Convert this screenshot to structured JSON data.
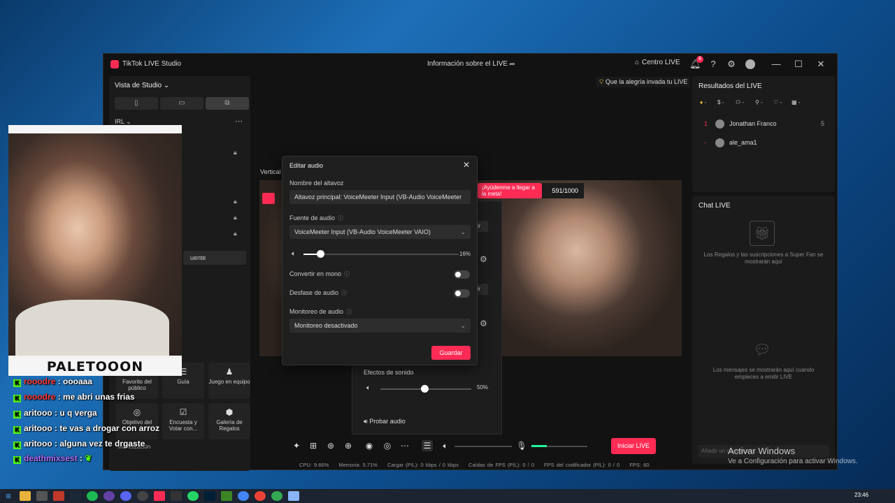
{
  "window": {
    "app_title": "TikTok LIVE Studio",
    "center_title": "Información sobre el LIVE",
    "live_center": "Centro LIVE",
    "notif_count": "8",
    "minimize": "—",
    "maximize": "☐",
    "close": "✕"
  },
  "left": {
    "studio_view": "Vista de Studio",
    "scene": "IRL",
    "add_source": "uente",
    "tools": [
      {
        "label": "Favorito del público",
        "icon": "★"
      },
      {
        "label": "Guía",
        "icon": "☰"
      },
      {
        "label": "Juego en equipo",
        "icon": "♟"
      },
      {
        "label": "Objetivo del",
        "icon": "◎"
      },
      {
        "label": "Encuesta y Votar con...",
        "icon": "☑"
      },
      {
        "label": "Galería de Regalos",
        "icon": "⬢"
      }
    ],
    "monetization": "Monetización"
  },
  "preview": {
    "label": "Vertical",
    "goal_text": "¡Ayúdenme a llegar a la meta!",
    "goal_count": "591/1000",
    "bulb_tip": "Que la alegría invada tu LIVE"
  },
  "audio_panel": {
    "edit": "dir",
    "edit2": "dir",
    "effects_label": "Efectos de sonido",
    "effects_pct": "50%",
    "test_audio": "Probar audio"
  },
  "dialog": {
    "title": "Editar audio",
    "speaker_label": "Nombre del altavoz",
    "speaker_value": "Altavoz principal: VoiceMeeter Input (VB-Audio VoiceMeeter",
    "source_label": "Fuente de audio",
    "source_value": "VoiceMeeter Input (VB-Audio VoiceMeeter VAIO)",
    "volume_pct": "16%",
    "volume_level": 0.16,
    "mono_label": "Convertir en mono",
    "offset_label": "Desfase de audio",
    "monitor_label": "Monitoreo de audio",
    "monitor_value": "Monitoreo desactivado",
    "save": "Guardar"
  },
  "results": {
    "title": "Resultados del LIVE",
    "filters": [
      "-",
      "-",
      "-",
      "-",
      "-",
      "-"
    ],
    "rows": [
      {
        "rank": "1",
        "name": "Jonathan Franco",
        "score": "5"
      },
      {
        "rank": "-",
        "name": "ale_ama1",
        "score": ""
      }
    ]
  },
  "chat": {
    "title": "Chat LIVE",
    "gifts_msg": "Los Regalos y las suscripciones a Super Fan se mostrarán aquí",
    "messages_msg": "Los mensajes se mostrarán aquí cuando empieces a emitir LIVE",
    "input_placeholder": "Añadir un comentario..."
  },
  "bottom": {
    "start_live": "Iniciar LIVE",
    "stats": {
      "cpu": "CPU: 9.66%",
      "memory": "Memoria: 5.71%",
      "upload": "Cargar (P/L): 0 kbps / 0 kbps",
      "fps_drop": "Caídas de FPS (P/L): 0 / 0",
      "encoder": "FPS del codificador (P/L): 0 / 0",
      "fps": "FPS: 60"
    }
  },
  "webcam": {
    "name": "PALETOOON"
  },
  "overlay_chat": [
    {
      "user": "rooodre",
      "msg": ": oooaaa",
      "color": "#ff3b3b"
    },
    {
      "user": "rooodre",
      "msg": ": me abri unas frias",
      "color": "#ff3b3b"
    },
    {
      "user": "aritooo",
      "msg": ": u q verga",
      "color": "#ffffff"
    },
    {
      "user": "aritooo",
      "msg": ": te vas a drogar con arroz",
      "color": "#ffffff"
    },
    {
      "user": "aritooo",
      "msg": ": alguna vez te drgaste",
      "color": "#ffffff"
    },
    {
      "user": "deathmixsest",
      "msg": ":",
      "color": "#b070ff"
    }
  ],
  "windows": {
    "activate_title": "Activar Windows",
    "activate_sub": "Ve a Configuración para activar Windows.",
    "clock": "23:46"
  },
  "colors": {
    "accent": "#fe2c55",
    "kick_green": "#53fc18"
  }
}
